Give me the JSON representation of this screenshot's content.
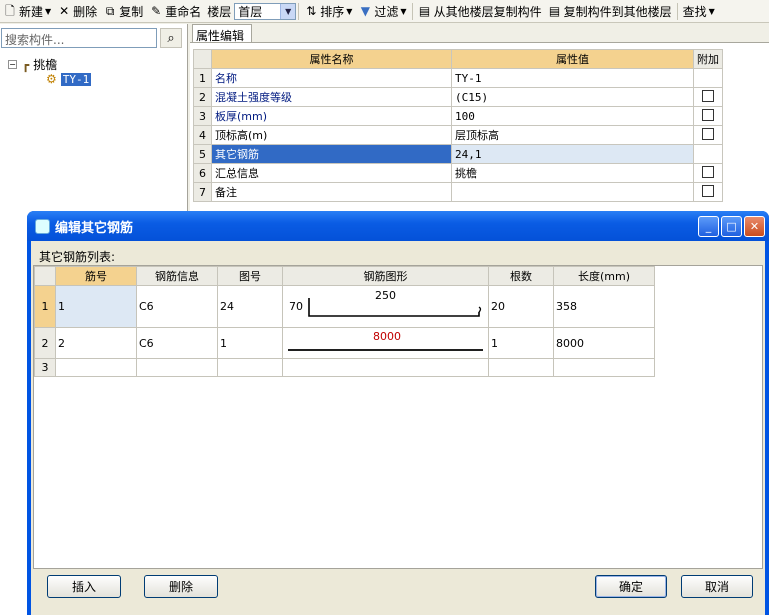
{
  "toolbar": {
    "new": "新建",
    "delete": "删除",
    "copy": "复制",
    "rename": "重命名",
    "floor_label": "楼层",
    "floor_value": "首层",
    "sort": "排序",
    "filter": "过滤",
    "copy_from": "从其他楼层复制构件",
    "copy_to": "复制构件到其他楼层",
    "find": "查找"
  },
  "left_panel": {
    "search_placeholder": "搜索构件...",
    "tree_root": "挑檐",
    "tree_child": "TY-1"
  },
  "property_editor": {
    "tab": "属性编辑",
    "headers": {
      "name": "属性名称",
      "value": "属性值",
      "extra": "附加"
    },
    "rows": [
      {
        "num": "1",
        "name": "名称",
        "value": "TY-1",
        "checkbox": false
      },
      {
        "num": "2",
        "name": "混凝土强度等级",
        "value": "(C15)",
        "checkbox": true
      },
      {
        "num": "3",
        "name": "板厚(mm)",
        "value": "100",
        "checkbox": true
      },
      {
        "num": "4",
        "name": "顶标高(m)",
        "value": "层顶标高",
        "checkbox": true
      },
      {
        "num": "5",
        "name": "其它钢筋",
        "value": "24,1",
        "checkbox": false
      },
      {
        "num": "6",
        "name": "汇总信息",
        "value": "挑檐",
        "checkbox": true
      },
      {
        "num": "7",
        "name": "备注",
        "value": "",
        "checkbox": true
      }
    ]
  },
  "dialog": {
    "title": "编辑其它钢筋",
    "list_label": "其它钢筋列表:",
    "headers": {
      "bar_no": "筋号",
      "bar_info": "钢筋信息",
      "shape_no": "图号",
      "shape": "钢筋图形",
      "count": "根数",
      "length": "长度(mm)"
    },
    "rows": [
      {
        "row": "1",
        "bar_no": "1",
        "bar_info": "C6",
        "shape_no": "24",
        "shape_left": "70",
        "shape_mid": "250",
        "count": "20",
        "length": "358"
      },
      {
        "row": "2",
        "bar_no": "2",
        "bar_info": "C6",
        "shape_no": "1",
        "shape_left": "",
        "shape_mid": "8000",
        "count": "1",
        "length": "8000"
      },
      {
        "row": "3",
        "bar_no": "",
        "bar_info": "",
        "shape_no": "",
        "shape_left": "",
        "shape_mid": "",
        "count": "",
        "length": ""
      }
    ],
    "buttons": {
      "insert": "插入",
      "delete": "删除",
      "ok": "确定",
      "cancel": "取消"
    }
  },
  "colors": {
    "selection": "#316ac5",
    "header_highlight": "#f4d28f",
    "title_bar": "#0054e3",
    "shape_value_red": "#c00000"
  }
}
